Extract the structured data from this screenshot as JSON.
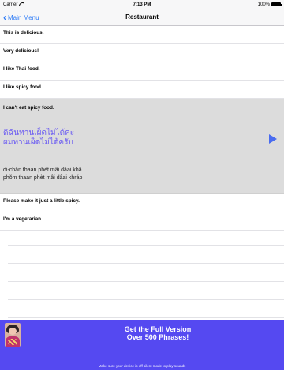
{
  "statusbar": {
    "carrier": "Carrier",
    "time": "7:13 PM",
    "battery": "100%"
  },
  "navbar": {
    "back_label": "Main Menu",
    "title": "Restaurant"
  },
  "phrases": [
    "This is delicious.",
    "Very delicious!",
    "I like Thai food.",
    "I like spicy food."
  ],
  "selected": {
    "english": "I can't eat spicy food.",
    "thai_line1": "ดิฉันทานเผ็ดไม่ได้ค่ะ",
    "thai_line2": "ผมทานเผ็ดไม่ได้ครับ",
    "translit_line1": "di-chăn thaan phèt mâi dâai khâ",
    "translit_line2": "phŏm thaan phèt mâi dâai khráp",
    "play_icon": "play-triangle"
  },
  "phrases_after": [
    "Please make it just a little spicy.",
    "I'm a vegetarian."
  ],
  "banner": {
    "line1": "Get the Full Version",
    "line2": "Over 500 Phrases!",
    "footnote": "Make sure your device is off silent mode to play sounds",
    "background": "#5549f1"
  },
  "colors": {
    "accent": "#2f7cf6",
    "thai_text": "#6b5cf2",
    "selected_row": "#dcdcdc"
  }
}
